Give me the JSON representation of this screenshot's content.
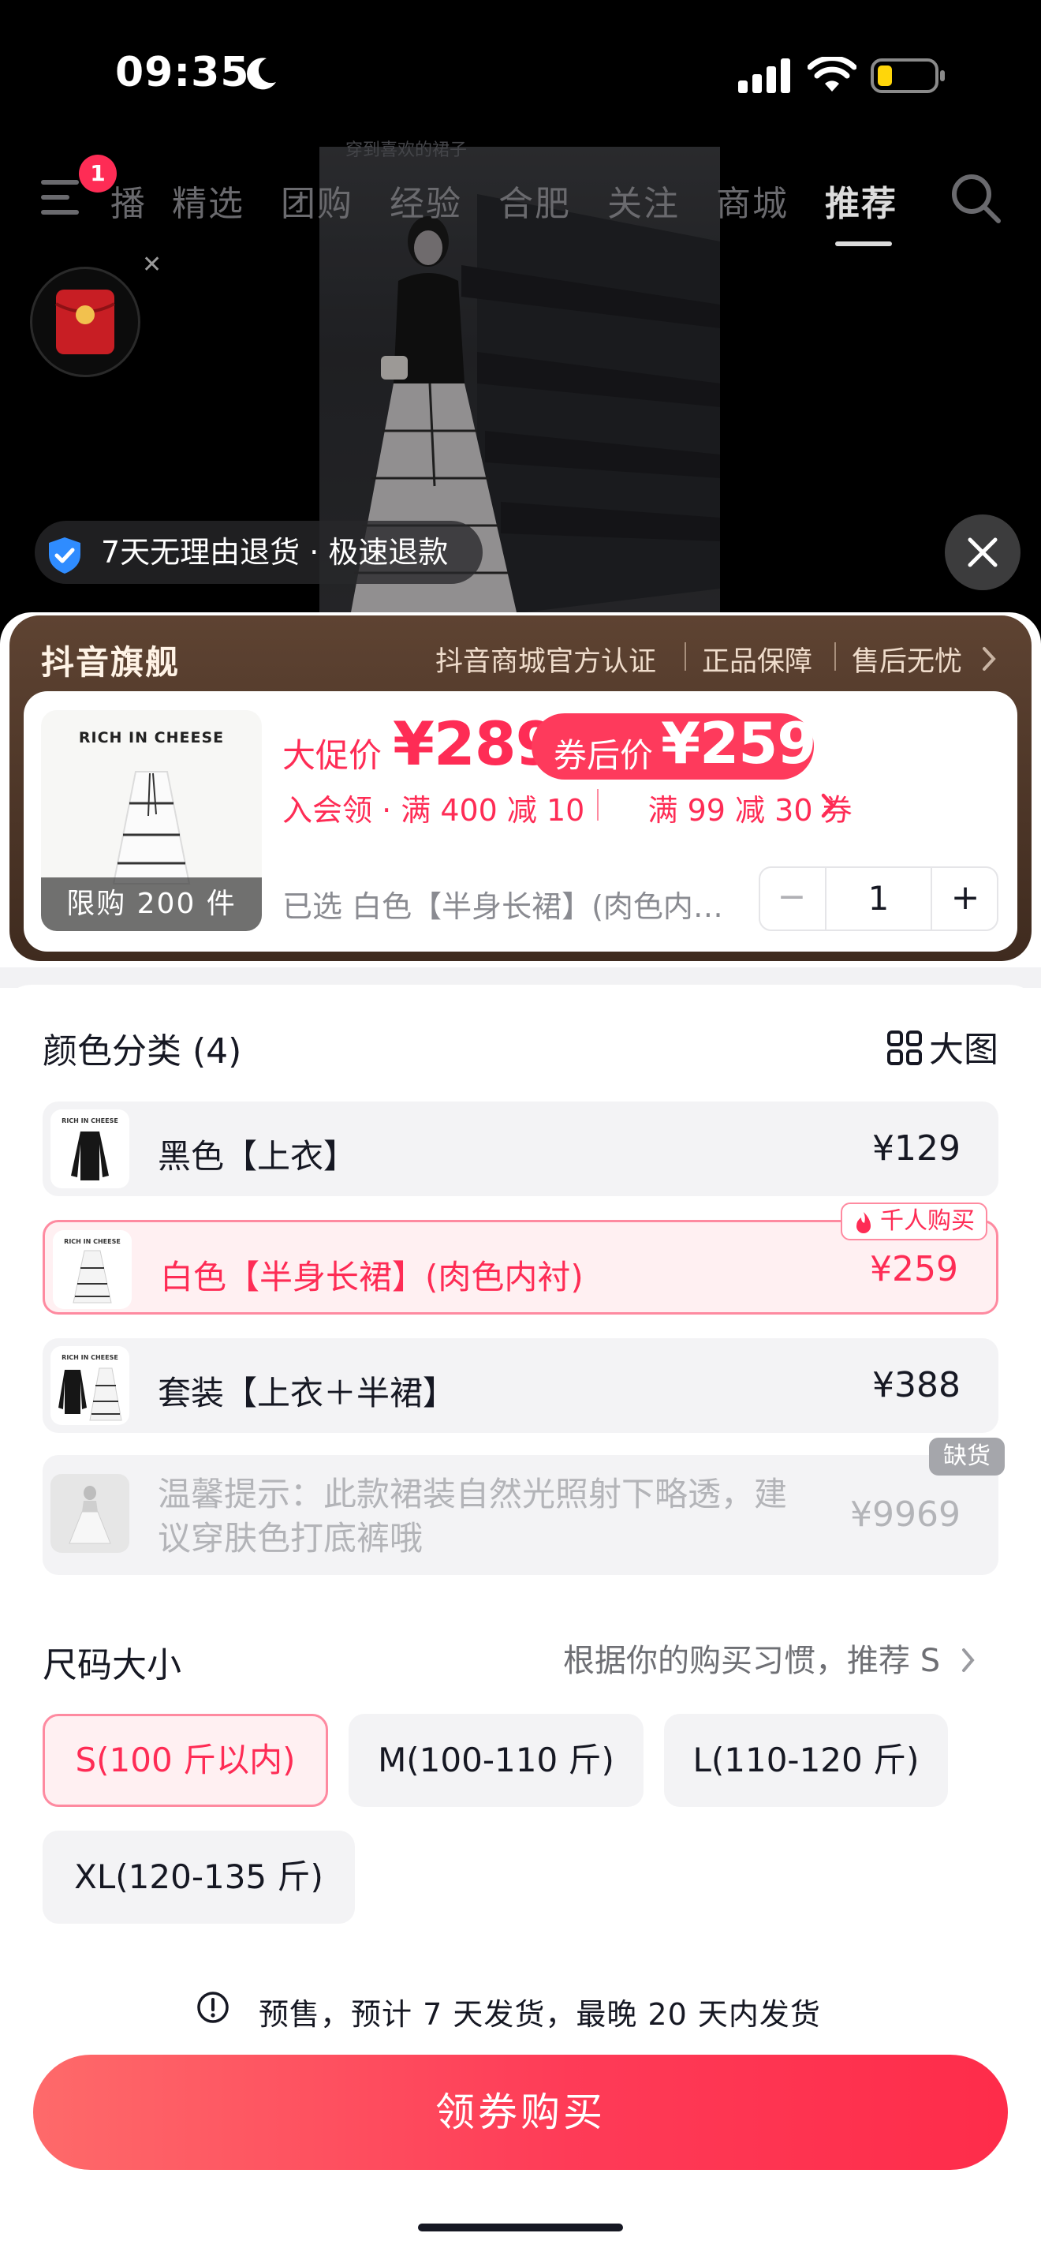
{
  "status_bar": {
    "time": "09:35"
  },
  "video": {
    "caption": "穿到喜欢的裙子"
  },
  "top_nav": {
    "badge_count": "1",
    "tabs": [
      {
        "label": "播"
      },
      {
        "label": "精选"
      },
      {
        "label": "团购"
      },
      {
        "label": "经验"
      },
      {
        "label": "合肥"
      },
      {
        "label": "关注"
      },
      {
        "label": "商城"
      },
      {
        "label": "推荐"
      }
    ],
    "active_tab": "推荐"
  },
  "guarantee": {
    "text": "7天无理由退货 · 极速退款"
  },
  "store": {
    "title": "抖音旗舰",
    "tags": [
      "抖音商城官方认证",
      "正品保障",
      "售后无忧"
    ]
  },
  "product": {
    "thumb_brand": "RICH IN CHEESE",
    "limit_text": "限购 200 件",
    "promo_label": "大促价",
    "promo_price": "¥289",
    "coupon_label": "券后价",
    "coupon_price": "¥259",
    "promo_line_1": "入会领 · 满 400 减 10",
    "promo_line_2": "满 99 减 30 券",
    "selected_text": "已选  白色【半身长裙】(肉色内衬)",
    "quantity": "1"
  },
  "color_section": {
    "title": "颜色分类 (4)",
    "big_view_label": "大图",
    "options": [
      {
        "label": "黑色【上衣】",
        "price": "¥129",
        "state": "normal"
      },
      {
        "label": "白色【半身长裙】(肉色内衬)",
        "price": "¥259",
        "state": "selected",
        "badge": "千人购买"
      },
      {
        "label": "套装【上衣＋半裙】",
        "price": "¥388",
        "state": "normal"
      },
      {
        "label_line1": "温馨提示：此款裙装自然光照射下略透，建",
        "label_line2": "议穿肤色打底裤哦",
        "price": "¥9969",
        "state": "out_of_stock",
        "badge": "缺货"
      }
    ]
  },
  "size_section": {
    "title": "尺码大小",
    "recommendation": "根据你的购买习惯，推荐 S",
    "options": [
      {
        "label": "S(100 斤以内)",
        "selected": true
      },
      {
        "label": "M(100-110 斤)",
        "selected": false
      },
      {
        "label": "L(110-120 斤)",
        "selected": false
      },
      {
        "label": "XL(120-135 斤)",
        "selected": false
      }
    ]
  },
  "footer": {
    "presale_text": "预售，预计 7 天发货，最晚 20 天内发货",
    "buy_button_label": "领券购买"
  },
  "colors": {
    "accent": "#fe2c55",
    "store_header": "#4a3326",
    "buy_button_start": "#fe6a6a",
    "buy_button_end": "#fe2c4a"
  }
}
